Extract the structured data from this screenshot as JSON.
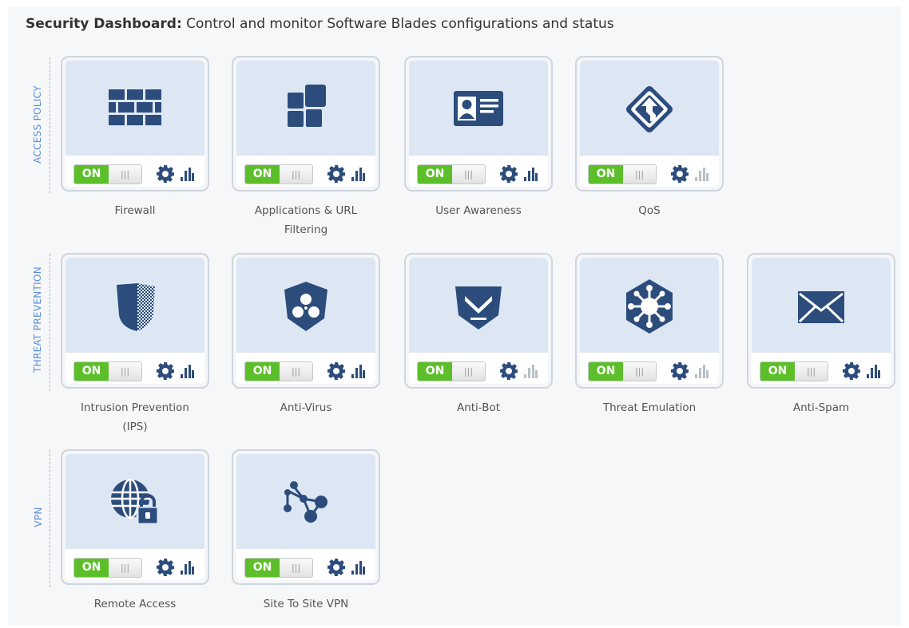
{
  "header": {
    "title_bold": "Security Dashboard:",
    "title_rest": " Control and monitor Software Blades configurations and status"
  },
  "sections": {
    "access_policy": "ACCESS POLICY",
    "threat_prevention": "THREAT PREVENTION",
    "vpn": "VPN"
  },
  "colors": {
    "icon": "#2c4c7c",
    "toggle_on": "#5cbf2a",
    "section_label": "#5a8fd6",
    "stats_inactive": "#b8bfc6"
  },
  "blades": [
    {
      "label": "Firewall",
      "label2": "",
      "icon": "firewall-brick-icon",
      "toggle": "ON",
      "stats_active": true
    },
    {
      "label": "Applications & URL",
      "label2": "Filtering",
      "icon": "applications-blocks-icon",
      "toggle": "ON",
      "stats_active": true
    },
    {
      "label": "User Awareness",
      "label2": "",
      "icon": "id-card-icon",
      "toggle": "ON",
      "stats_active": true
    },
    {
      "label": "QoS",
      "label2": "",
      "icon": "qos-diamond-arrow-icon",
      "toggle": "ON",
      "stats_active": false
    },
    {
      "label": "Intrusion Prevention",
      "label2": "(IPS)",
      "icon": "ips-shield-icon",
      "toggle": "ON",
      "stats_active": true
    },
    {
      "label": "Anti-Virus",
      "label2": "",
      "icon": "biohazard-shield-icon",
      "toggle": "ON",
      "stats_active": true
    },
    {
      "label": "Anti-Bot",
      "label2": "",
      "icon": "anti-bot-shield-icon",
      "toggle": "ON",
      "stats_active": false
    },
    {
      "label": "Threat Emulation",
      "label2": "",
      "icon": "virus-hexagon-icon",
      "toggle": "ON",
      "stats_active": false
    },
    {
      "label": "Anti-Spam",
      "label2": "",
      "icon": "envelope-icon",
      "toggle": "ON",
      "stats_active": true
    },
    {
      "label": "Remote Access",
      "label2": "",
      "icon": "globe-lock-icon",
      "toggle": "ON",
      "stats_active": true
    },
    {
      "label": "Site To Site VPN",
      "label2": "",
      "icon": "network-nodes-icon",
      "toggle": "ON",
      "stats_active": true
    }
  ]
}
